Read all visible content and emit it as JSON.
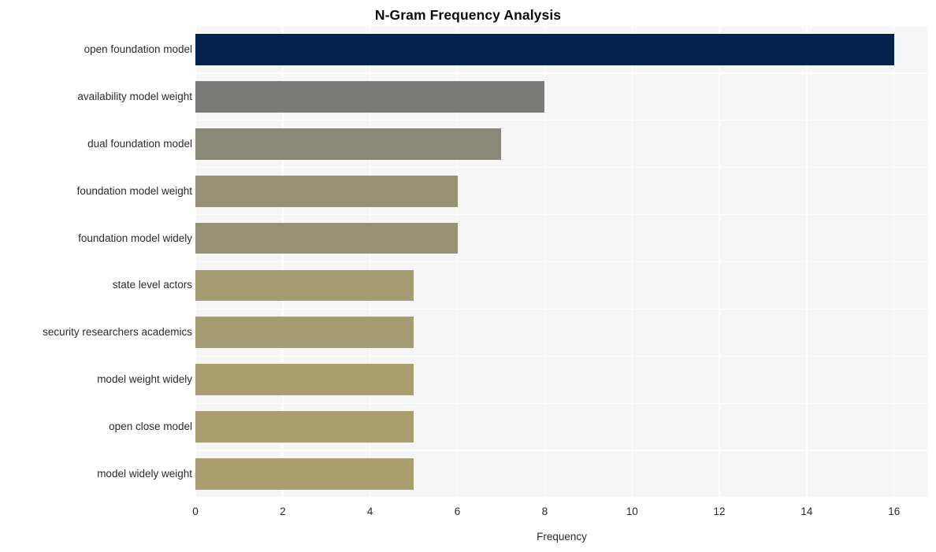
{
  "chart_data": {
    "type": "bar",
    "orientation": "horizontal",
    "title": "N-Gram Frequency Analysis",
    "xlabel": "Frequency",
    "ylabel": "",
    "categories": [
      "open foundation model",
      "availability model weight",
      "dual foundation model",
      "foundation model weight",
      "foundation model widely",
      "state level actors",
      "security researchers academics",
      "model weight widely",
      "open close model",
      "model widely weight"
    ],
    "values": [
      16,
      8,
      7,
      6,
      6,
      5,
      5,
      5,
      5,
      5
    ],
    "bar_colors": [
      "#04224c",
      "#7a7a78",
      "#8a8878",
      "#989274",
      "#989274",
      "#a49c72",
      "#a49c72",
      "#a89e70",
      "#a89e70",
      "#a89e70"
    ],
    "xlim": [
      0,
      16.78
    ],
    "xticks": [
      0,
      2,
      4,
      6,
      8,
      10,
      12,
      14,
      16
    ],
    "xtick_labels": [
      "0",
      "2",
      "4",
      "6",
      "8",
      "10",
      "12",
      "14",
      "16"
    ],
    "grid": true,
    "legend": null,
    "plot_background": "#f6f6f7",
    "figure_background": "#ffffff",
    "gridline_color": "#ffffff",
    "title_color": "#0d0d0d",
    "tick_color": "#2b2b2b"
  }
}
